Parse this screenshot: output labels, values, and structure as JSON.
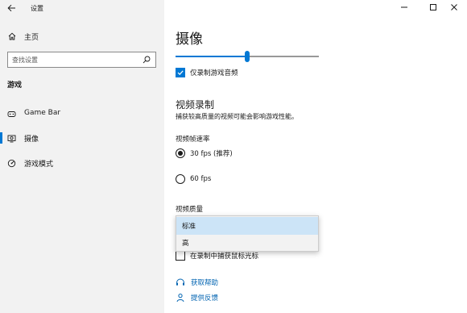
{
  "window": {
    "title": "设置",
    "accent": "#0078d4"
  },
  "sidebar": {
    "home_label": "主页",
    "search": {
      "placeholder": "查找设置",
      "value": ""
    },
    "section_title": "游戏",
    "items": [
      {
        "label": "Game Bar",
        "icon": "game-bar-icon",
        "selected": false
      },
      {
        "label": "摄像",
        "icon": "capture-icon",
        "selected": true
      },
      {
        "label": "游戏模式",
        "icon": "game-mode-icon",
        "selected": false
      }
    ]
  },
  "main": {
    "page_title": "摄像",
    "audio_volume_fraction": 0.5,
    "record_game_audio_only": {
      "label": "仅录制游戏音频",
      "checked": true
    },
    "video_section": {
      "title": "视频录制",
      "hint": "捕获较高质量的视频可能会影响游戏性能。"
    },
    "frame_rate": {
      "label": "视频帧速率",
      "options": [
        {
          "label": "30 fps (推荐)",
          "checked": true
        },
        {
          "label": "60 fps",
          "checked": false
        }
      ]
    },
    "video_quality": {
      "label": "视频质量",
      "options": [
        {
          "label": "标准",
          "selected": true
        },
        {
          "label": "高",
          "selected": false
        }
      ]
    },
    "capture_mouse": {
      "label": "在录制中捕获鼠标光标",
      "checked": false
    },
    "links": {
      "help": "获取帮助",
      "feedback": "提供反馈"
    }
  }
}
